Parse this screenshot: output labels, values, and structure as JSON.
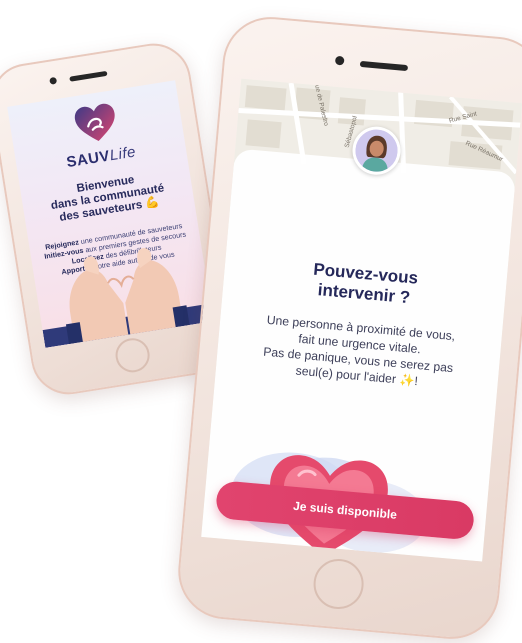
{
  "left_phone": {
    "brand_bold": "SAUV",
    "brand_light": "Life",
    "welcome_line1": "Bienvenue",
    "welcome_line2": "dans la communauté",
    "welcome_line3": "des sauveteurs 💪",
    "features": [
      {
        "bold": "Rejoignez",
        "text": " une communauté de sauveteurs"
      },
      {
        "bold": "Initiez-vous",
        "text": " aux premiers gestes de secours"
      },
      {
        "bold": "Localisez",
        "text": " des défibrillateurs"
      },
      {
        "bold": "Apportez",
        "text": " votre aide autour de vous"
      }
    ]
  },
  "right_phone": {
    "map_labels": [
      "Rue de Palestro",
      "Rue Saint",
      "Rue Réaumur",
      "Sébastopol"
    ],
    "question_line1": "Pouvez-vous",
    "question_line2": "intervenir ?",
    "body_line1": "Une personne à proximité de vous,",
    "body_line2": "fait une urgence vitale.",
    "body_line3": "Pas de panique, vous ne serez pas",
    "body_line4": "seul(e) pour l'aider",
    "body_suffix": "!",
    "body_sparkle": "✨",
    "cta_label": "Je suis disponible"
  },
  "colors": {
    "brand_navy": "#272a5c",
    "cta_pink": "#e1446e",
    "phone_shell": "#f1e3dc"
  },
  "icons": [
    "sauvlife-heart-logo",
    "avatar-icon",
    "heart-illustration",
    "hands-heart-illustration"
  ]
}
